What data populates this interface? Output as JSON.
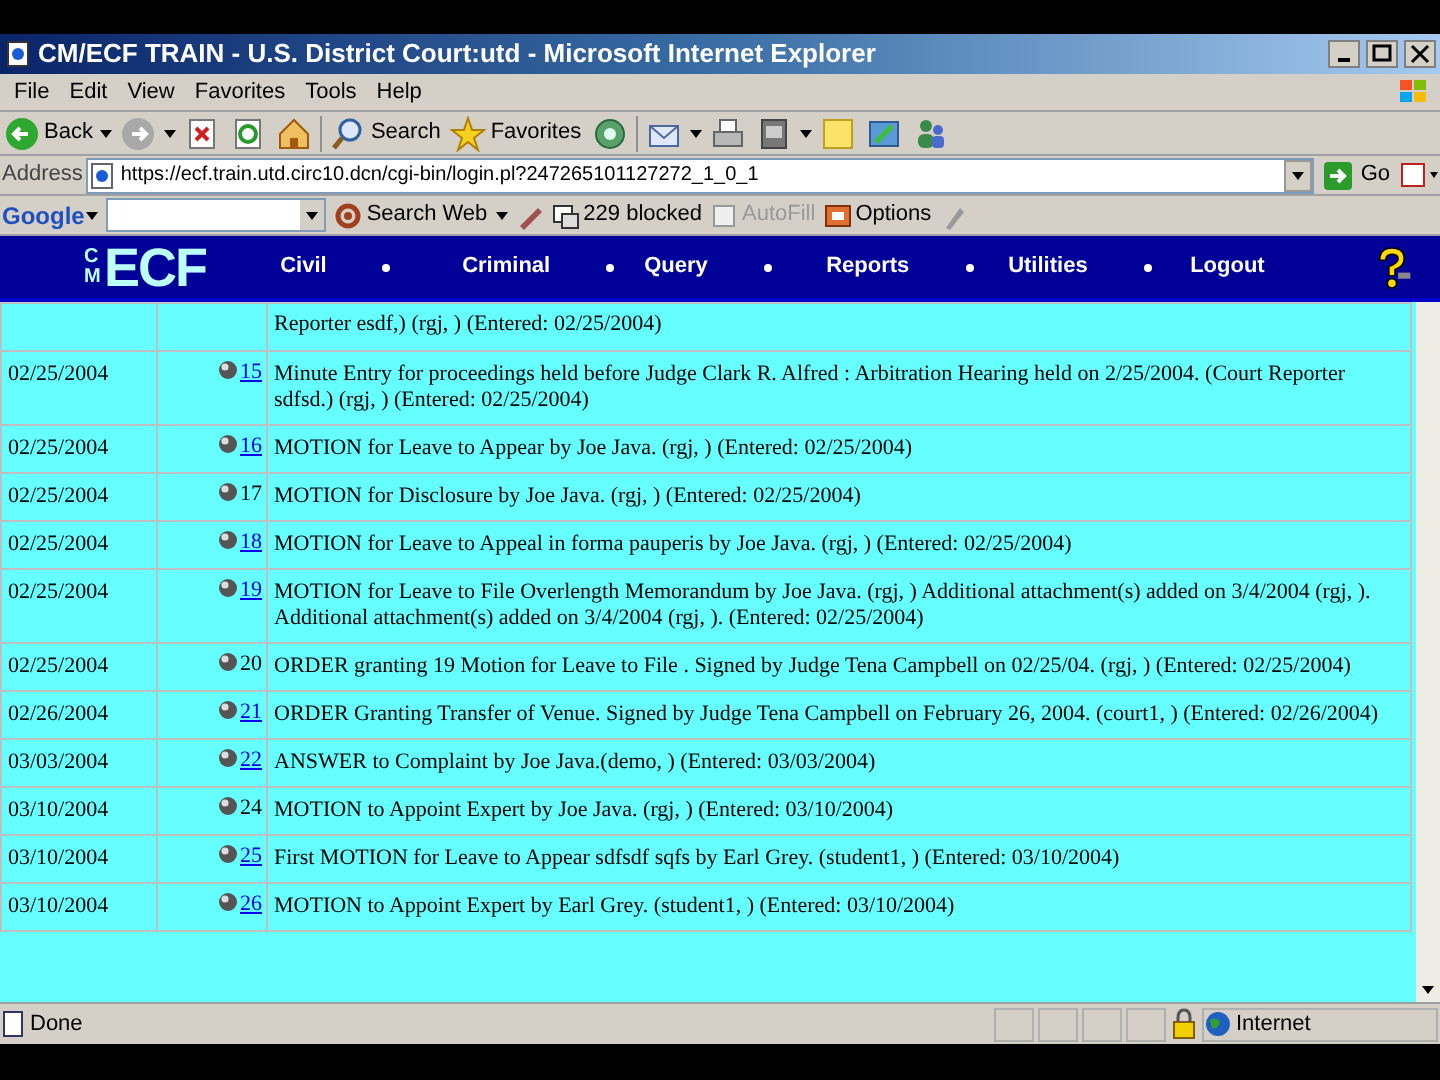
{
  "window": {
    "title": "CM/ECF TRAIN - U.S. District Court:utd - Microsoft Internet Explorer"
  },
  "menu": [
    "File",
    "Edit",
    "View",
    "Favorites",
    "Tools",
    "Help"
  ],
  "toolbar": [
    {
      "kind": "back",
      "label": "Back",
      "dropdown": true
    },
    {
      "kind": "forward",
      "dropdown": true
    },
    {
      "kind": "stop"
    },
    {
      "kind": "refresh"
    },
    {
      "kind": "home"
    },
    {
      "kind": "search",
      "label": "Search"
    },
    {
      "kind": "favorites",
      "label": "Favorites"
    },
    {
      "kind": "media"
    },
    {
      "kind": "mail",
      "dropdown": true
    },
    {
      "kind": "print"
    },
    {
      "kind": "edit",
      "dropdown": true
    },
    {
      "kind": "note"
    },
    {
      "kind": "messenger"
    },
    {
      "kind": "people"
    }
  ],
  "address_bar": {
    "label": "Address",
    "url": "https://ecf.train.utd.circ10.dcn/cgi-bin/login.pl?247265101127272_1_0_1",
    "go": "Go"
  },
  "google_bar": {
    "logo": "Google",
    "search_button": "Search Web",
    "blocked": "229 blocked",
    "autofill": "AutoFill",
    "options": "Options"
  },
  "ecf_nav": {
    "logo_small": "CM",
    "logo": "ECF",
    "items": [
      {
        "label": "Civil",
        "has_menu": true
      },
      {
        "label": "Criminal",
        "has_menu": true
      },
      {
        "label": "Query",
        "has_menu": true
      },
      {
        "label": "Reports",
        "has_menu": true
      },
      {
        "label": "Utilities",
        "has_menu": true
      },
      {
        "label": "Logout",
        "has_menu": false
      }
    ]
  },
  "docket": {
    "rows": [
      {
        "date": "",
        "number": "",
        "text": "Reporter esdf,) (rgj, ) (Entered: 02/25/2004)"
      },
      {
        "date": "02/25/2004",
        "number": "15",
        "linked": true,
        "text": "Minute Entry for proceedings held before Judge Clark R. Alfred : Arbitration Hearing held on 2/25/2004. (Court Reporter sdfsd.) (rgj, ) (Entered: 02/25/2004)"
      },
      {
        "date": "02/25/2004",
        "number": "16",
        "linked": true,
        "text": "MOTION for Leave to Appear by Joe Java. (rgj, ) (Entered: 02/25/2004)"
      },
      {
        "date": "02/25/2004",
        "number": "17",
        "linked": false,
        "text": "MOTION for Disclosure by Joe Java. (rgj, ) (Entered: 02/25/2004)"
      },
      {
        "date": "02/25/2004",
        "number": "18",
        "linked": true,
        "text": "MOTION for Leave to Appeal in forma pauperis by Joe Java. (rgj, ) (Entered: 02/25/2004)"
      },
      {
        "date": "02/25/2004",
        "number": "19",
        "linked": true,
        "text": "MOTION for Leave to File Overlength Memorandum by Joe Java. (rgj, ) Additional attachment(s) added on 3/4/2004 (rgj, ). Additional attachment(s) added on 3/4/2004 (rgj, ). (Entered: 02/25/2004)"
      },
      {
        "date": "02/25/2004",
        "number": "20",
        "linked": false,
        "text": "ORDER granting 19 Motion for Leave to File . Signed by Judge Tena Campbell on 02/25/04. (rgj, ) (Entered: 02/25/2004)"
      },
      {
        "date": "02/26/2004",
        "number": "21",
        "linked": true,
        "text": "ORDER Granting Transfer of Venue. Signed by Judge Tena Campbell on February 26, 2004. (court1, ) (Entered: 02/26/2004)"
      },
      {
        "date": "03/03/2004",
        "number": "22",
        "linked": true,
        "text": "ANSWER to Complaint by Joe Java.(demo, ) (Entered: 03/03/2004)"
      },
      {
        "date": "03/10/2004",
        "number": "24",
        "linked": false,
        "text": "MOTION to Appoint Expert by Joe Java. (rgj, ) (Entered: 03/10/2004)"
      },
      {
        "date": "03/10/2004",
        "number": "25",
        "linked": true,
        "text": "First MOTION for Leave to Appear sdfsdf sqfs by Earl Grey. (student1, ) (Entered: 03/10/2004)"
      },
      {
        "date": "03/10/2004",
        "number": "26",
        "linked": true,
        "text": "MOTION to Appoint Expert by Earl Grey. (student1, ) (Entered: 03/10/2004)"
      }
    ]
  },
  "status_bar": {
    "text": "Done",
    "zone": "Internet"
  }
}
